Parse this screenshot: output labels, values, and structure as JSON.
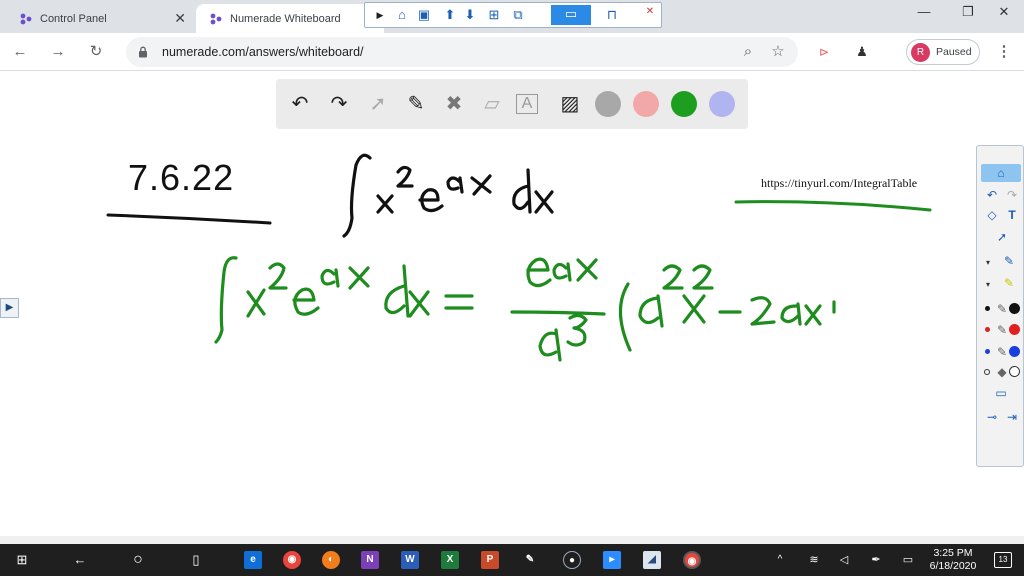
{
  "browser": {
    "tabs": [
      {
        "title": "Control Panel",
        "active": false
      },
      {
        "title": "Numerade Whiteboard",
        "active": true
      }
    ],
    "url": "numerade.com/answers/whiteboard/",
    "profile_initial": "R",
    "profile_status": "Paused"
  },
  "whiteboard": {
    "tools": [
      "undo-icon",
      "redo-icon",
      "select-icon",
      "pen-icon",
      "clear-icon",
      "eraser-icon",
      "text-icon",
      "image-icon"
    ],
    "colors": [
      "#a8a8a8",
      "#f2a8a8",
      "#1e9e1e",
      "#b0b4f0"
    ],
    "selected_color": "#1e9e1e",
    "handwriting": {
      "problem_number": "7.6.22",
      "reference_link": "https://tinyurl.com/IntegralTable"
    }
  },
  "taskbar": {
    "time": "3:25 PM",
    "date": "6/18/2020",
    "notification_count": "13"
  }
}
